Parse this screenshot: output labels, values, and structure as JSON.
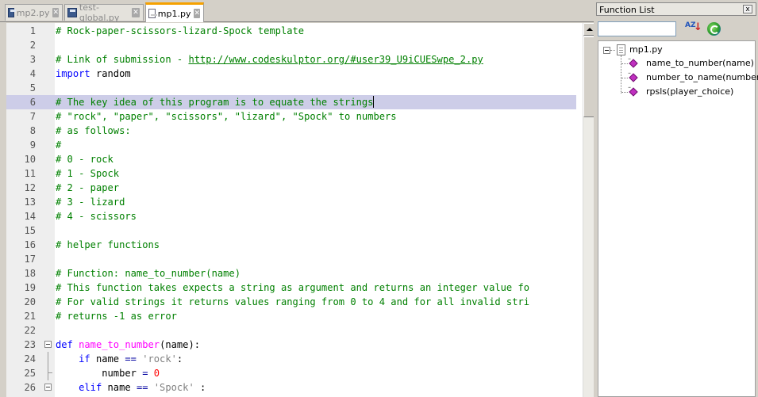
{
  "tabs": [
    {
      "label": "mp2.py",
      "active": false
    },
    {
      "label": "test-global.py",
      "active": false
    },
    {
      "label": "mp1.py",
      "active": true
    }
  ],
  "editor": {
    "highlight_line": 6,
    "lines": [
      {
        "n": "1",
        "segs": [
          {
            "t": "# Rock-paper-scissors-lizard-Spock template",
            "c": "com"
          }
        ]
      },
      {
        "n": "2",
        "segs": []
      },
      {
        "n": "3",
        "segs": [
          {
            "t": "# Link of submission - ",
            "c": "com"
          },
          {
            "t": "http://www.codeskulptor.org/#user39_U9iCUESwpe_2.py",
            "c": "link"
          }
        ]
      },
      {
        "n": "4",
        "segs": [
          {
            "t": "import",
            "c": "kw"
          },
          {
            "t": " random",
            "c": ""
          }
        ]
      },
      {
        "n": "5",
        "segs": []
      },
      {
        "n": "6",
        "segs": [
          {
            "t": "# The key idea of this program is to equate the strings",
            "c": "com"
          }
        ],
        "caret": true
      },
      {
        "n": "7",
        "segs": [
          {
            "t": "# \"rock\", \"paper\", \"scissors\", \"lizard\", \"Spock\" to numbers",
            "c": "com"
          }
        ]
      },
      {
        "n": "8",
        "segs": [
          {
            "t": "# as follows:",
            "c": "com"
          }
        ]
      },
      {
        "n": "9",
        "segs": [
          {
            "t": "#",
            "c": "com"
          }
        ]
      },
      {
        "n": "10",
        "segs": [
          {
            "t": "# 0 - rock",
            "c": "com"
          }
        ]
      },
      {
        "n": "11",
        "segs": [
          {
            "t": "# 1 - Spock",
            "c": "com"
          }
        ]
      },
      {
        "n": "12",
        "segs": [
          {
            "t": "# 2 - paper",
            "c": "com"
          }
        ]
      },
      {
        "n": "13",
        "segs": [
          {
            "t": "# 3 - lizard",
            "c": "com"
          }
        ]
      },
      {
        "n": "14",
        "segs": [
          {
            "t": "# 4 - scissors",
            "c": "com"
          }
        ]
      },
      {
        "n": "15",
        "segs": []
      },
      {
        "n": "16",
        "segs": [
          {
            "t": "# helper functions",
            "c": "com"
          }
        ]
      },
      {
        "n": "17",
        "segs": []
      },
      {
        "n": "18",
        "segs": [
          {
            "t": "# Function: name_to_number(name)",
            "c": "com"
          }
        ]
      },
      {
        "n": "19",
        "segs": [
          {
            "t": "# This function takes expects a string as argument and returns an integer value fo",
            "c": "com"
          }
        ]
      },
      {
        "n": "20",
        "segs": [
          {
            "t": "# For valid strings it returns values ranging from 0 to 4 and for all invalid stri",
            "c": "com"
          }
        ]
      },
      {
        "n": "21",
        "segs": [
          {
            "t": "# returns -1 as error",
            "c": "com"
          }
        ]
      },
      {
        "n": "22",
        "segs": []
      },
      {
        "n": "23",
        "fold": "open",
        "segs": [
          {
            "t": "def",
            "c": "kw"
          },
          {
            "t": " ",
            "c": ""
          },
          {
            "t": "name_to_number",
            "c": "fn"
          },
          {
            "t": "(name):",
            "c": ""
          }
        ]
      },
      {
        "n": "24",
        "fold": "line",
        "segs": [
          {
            "t": "    ",
            "c": ""
          },
          {
            "t": "if",
            "c": "kw"
          },
          {
            "t": " name ",
            "c": ""
          },
          {
            "t": "==",
            "c": "op"
          },
          {
            "t": " ",
            "c": ""
          },
          {
            "t": "'rock'",
            "c": "str"
          },
          {
            "t": ":",
            "c": ""
          }
        ]
      },
      {
        "n": "25",
        "fold": "tick",
        "segs": [
          {
            "t": "        number ",
            "c": ""
          },
          {
            "t": "=",
            "c": "op"
          },
          {
            "t": " ",
            "c": ""
          },
          {
            "t": "0",
            "c": "num"
          }
        ]
      },
      {
        "n": "26",
        "fold": "open",
        "segs": [
          {
            "t": "    ",
            "c": ""
          },
          {
            "t": "elif",
            "c": "kw"
          },
          {
            "t": " name ",
            "c": ""
          },
          {
            "t": "==",
            "c": "op"
          },
          {
            "t": " ",
            "c": ""
          },
          {
            "t": "'Spock'",
            "c": "str"
          },
          {
            "t": " :",
            "c": ""
          }
        ]
      }
    ]
  },
  "function_list": {
    "title": "Function List",
    "close_label": "x",
    "search_value": "",
    "sort_label": "AZ",
    "file": "mp1.py",
    "functions": [
      "name_to_number(name)",
      "number_to_name(number)",
      "rpsls(player_choice)"
    ]
  }
}
